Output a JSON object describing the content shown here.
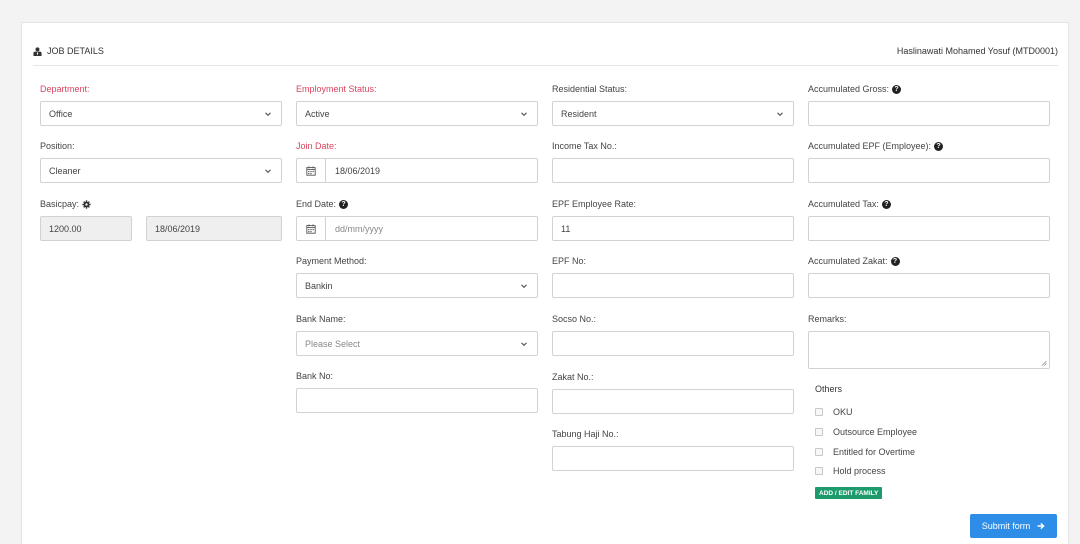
{
  "header": {
    "title": "JOB DETAILS",
    "employee": "Haslinawati Mohamed Yosuf (MTD0001)"
  },
  "col1": {
    "department_label": "Department:",
    "department_value": "Office",
    "position_label": "Position:",
    "position_value": "Cleaner",
    "basicpay_label": "Basicpay:",
    "basicpay_value": "1200.00",
    "basicpay_date": "18/06/2019"
  },
  "col2": {
    "employment_status_label": "Employment Status:",
    "employment_status_value": "Active",
    "join_date_label": "Join Date:",
    "join_date_value": "18/06/2019",
    "end_date_label": "End Date:",
    "end_date_placeholder": "dd/mm/yyyy",
    "payment_method_label": "Payment Method:",
    "payment_method_value": "Bankin",
    "bank_name_label": "Bank Name:",
    "bank_name_placeholder": "Please Select",
    "bank_no_label": "Bank No:"
  },
  "col3": {
    "residential_status_label": "Residential Status:",
    "residential_status_value": "Resident",
    "income_tax_label": "Income Tax No.:",
    "epf_rate_label": "EPF Employee Rate:",
    "epf_rate_value": "11",
    "epf_no_label": "EPF No:",
    "socso_label": "Socso No.:",
    "zakat_label": "Zakat No.:",
    "tabung_haji_label": "Tabung Haji No.:"
  },
  "col4": {
    "acc_gross_label": "Accumulated Gross:",
    "acc_epf_label": "Accumulated EPF (Employee):",
    "acc_tax_label": "Accumulated Tax:",
    "acc_zakat_label": "Accumulated Zakat:",
    "remarks_label": "Remarks:",
    "others_title": "Others",
    "others": [
      "OKU",
      "Outsource Employee",
      "Entitled for Overtime",
      "Hold process"
    ],
    "family_button": "ADD / EDIT FAMILY"
  },
  "submit_label": "Submit form",
  "colors": {
    "required": "#d9455f",
    "primary": "#2e8de6",
    "success": "#1d9b6c"
  },
  "icons": [
    "user-icon",
    "gear-icon",
    "question-icon",
    "calendar-icon",
    "chevron-down-icon",
    "arrow-right-icon"
  ]
}
